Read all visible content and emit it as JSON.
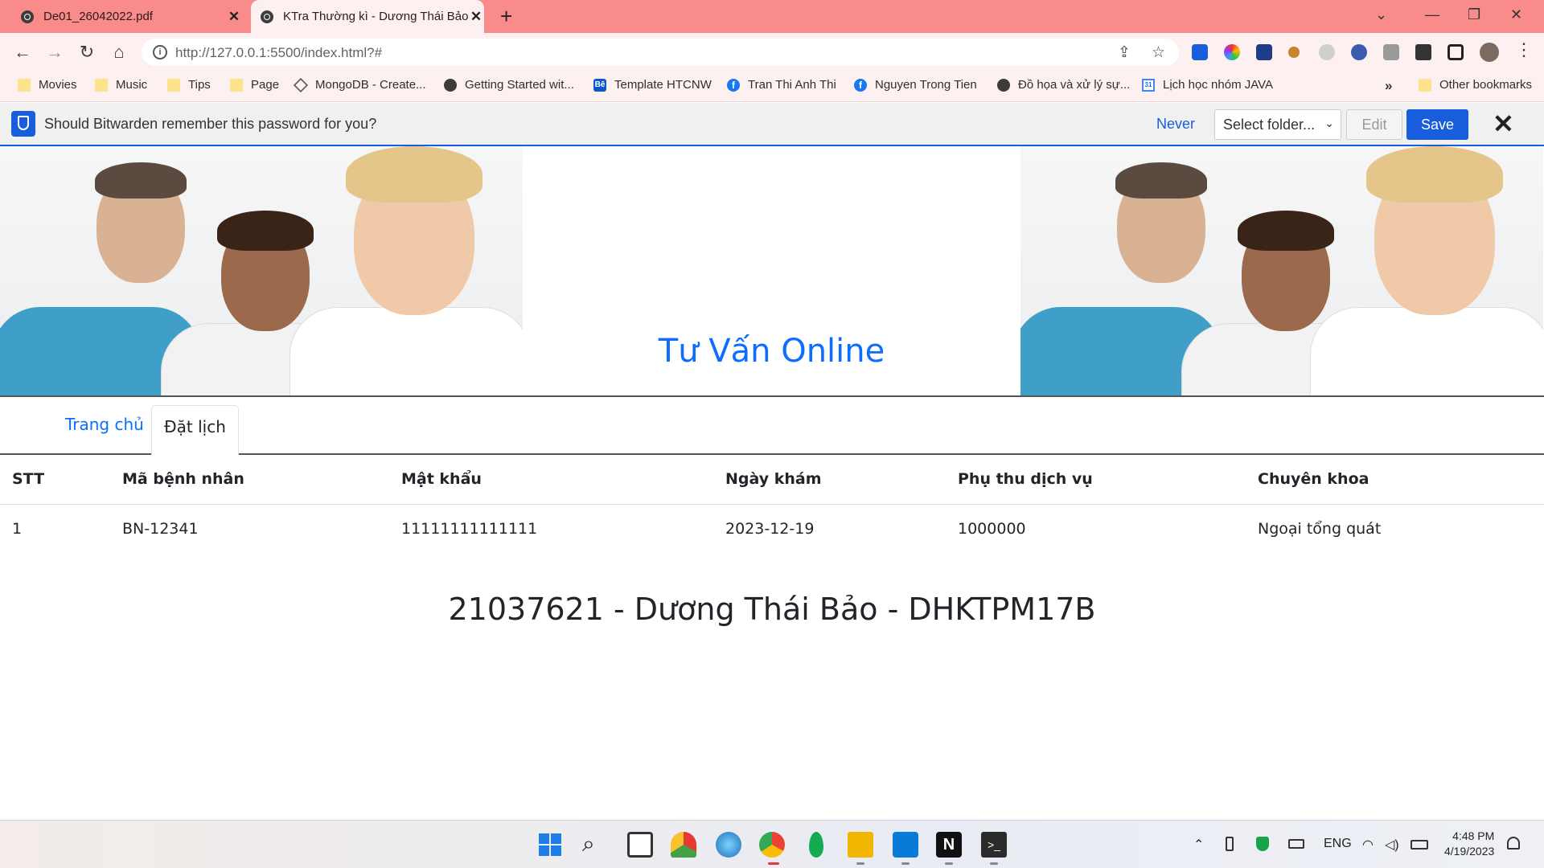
{
  "browser": {
    "tabs": [
      {
        "title": "De01_26042022.pdf",
        "close": "✕"
      },
      {
        "title": "KTra Thường kì - Dương Thái Bảo",
        "close": "✕"
      }
    ],
    "new_tab": "+",
    "url": "http://127.0.0.1:5500/index.html?#",
    "window_controls": {
      "dropdown": "⌄",
      "minimize": "—",
      "restore": "❐",
      "close": "✕"
    },
    "nav": {
      "back": "←",
      "forward": "→",
      "reload": "↻",
      "home": "⌂"
    },
    "menu": "⋮"
  },
  "bookmarks": {
    "items": [
      {
        "label": "Movies",
        "icon": "folder-icon"
      },
      {
        "label": "Music",
        "icon": "folder-icon"
      },
      {
        "label": "Tips",
        "icon": "folder-icon"
      },
      {
        "label": "Page",
        "icon": "folder-icon"
      },
      {
        "label": "MongoDB - Create...",
        "icon": "mongodb-icon"
      },
      {
        "label": "Getting Started wit...",
        "icon": "globe-icon"
      },
      {
        "label": "Template HTCNW",
        "icon": "behance-icon",
        "glyph": "Bē"
      },
      {
        "label": "Tran Thi Anh Thi",
        "icon": "facebook-icon",
        "glyph": "f"
      },
      {
        "label": "Nguyen Trong Tien",
        "icon": "facebook-icon",
        "glyph": "f"
      },
      {
        "label": "Đồ họa và xử lý sự...",
        "icon": "globe-icon"
      },
      {
        "label": "Lịch học nhóm JAVA",
        "icon": "calendar-icon",
        "glyph": "31"
      }
    ],
    "overflow": "»",
    "other": "Other bookmarks"
  },
  "bitwarden": {
    "message": "Should Bitwarden remember this password for you?",
    "never": "Never",
    "folder_select": "Select folder...",
    "edit": "Edit",
    "save": "Save",
    "close": "✕",
    "accent": "#175ddc"
  },
  "page": {
    "title": "Tư Vấn Online",
    "title_color": "#0d6efd",
    "nav": {
      "home": "Trang chủ",
      "active": "Đặt lịch"
    },
    "table": {
      "headers": [
        "STT",
        "Mã bệnh nhân",
        "Mật khẩu",
        "Ngày khám",
        "Phụ thu dịch vụ",
        "Chuyên khoa"
      ],
      "rows": [
        [
          "1",
          "BN-12341",
          "11111111111111",
          "2023-12-19",
          "1000000",
          "Ngoại tổng quát"
        ]
      ]
    },
    "footer": "21037621 - Dương Thái Bảo - DHKTPM17B"
  },
  "taskbar": {
    "tray": {
      "chevron": "⌃",
      "lang": "ENG"
    },
    "clock": {
      "time": "4:48 PM",
      "date": "4/19/2023"
    }
  }
}
